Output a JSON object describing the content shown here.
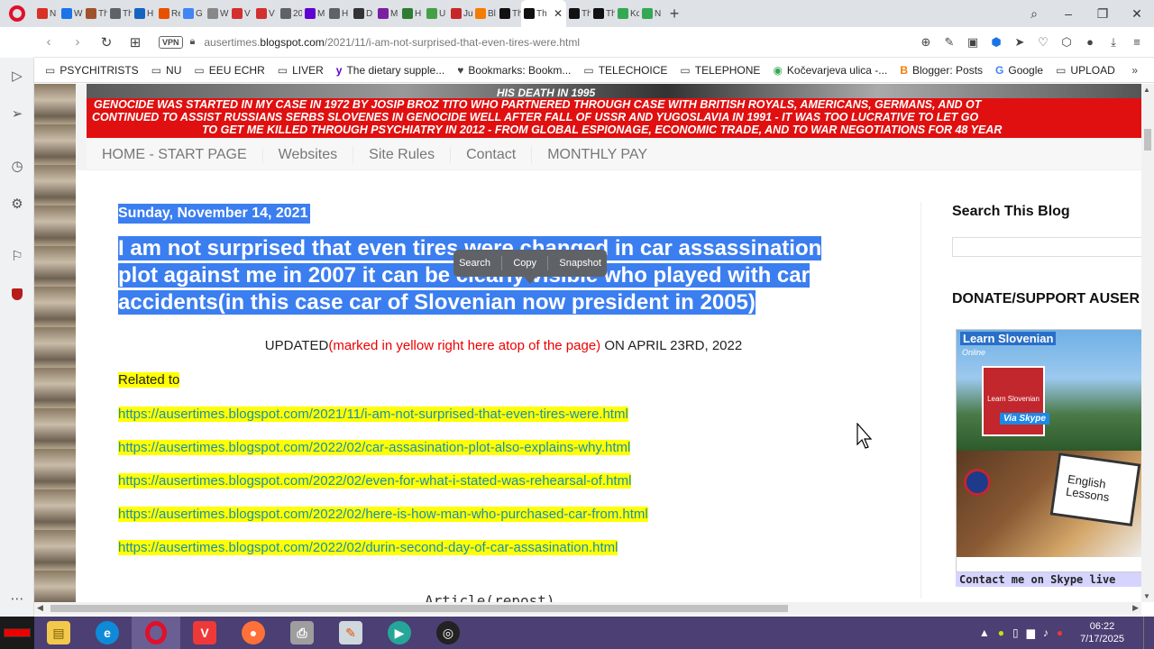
{
  "tabs": [
    {
      "label": "N",
      "color": "#d93025"
    },
    {
      "label": "W",
      "color": "#1a73e8"
    },
    {
      "label": "Th",
      "color": "#a0522d"
    },
    {
      "label": "Th",
      "color": "#5f6368"
    },
    {
      "label": "H",
      "color": "#1565c0"
    },
    {
      "label": "Re",
      "color": "#e65100"
    },
    {
      "label": "G",
      "color": "#4285f4"
    },
    {
      "label": "W",
      "color": "#888888"
    },
    {
      "label": "V",
      "color": "#d32f2f"
    },
    {
      "label": "V",
      "color": "#d32f2f"
    },
    {
      "label": "20",
      "color": "#5f6368"
    },
    {
      "label": "M",
      "color": "#6001d2"
    },
    {
      "label": "H",
      "color": "#5f6368"
    },
    {
      "label": "D",
      "color": "#333333"
    },
    {
      "label": "M",
      "color": "#7b1fa2"
    },
    {
      "label": "H",
      "color": "#2e7d32"
    },
    {
      "label": "U",
      "color": "#43a047"
    },
    {
      "label": "Ju",
      "color": "#c62828"
    },
    {
      "label": "Bl",
      "color": "#f57c00"
    },
    {
      "label": "Th",
      "color": "#111111"
    }
  ],
  "active_tab": {
    "label": "Th"
  },
  "tabs_after": [
    {
      "label": "Th",
      "color": "#111111"
    },
    {
      "label": "Th",
      "color": "#111111"
    },
    {
      "label": "Kc",
      "color": "#34a853"
    },
    {
      "label": "N",
      "color": "#34a853"
    }
  ],
  "address": {
    "url_prefix": "ausertimes.",
    "url_domain": "blogspot.com",
    "url_path": "/2021/11/i-am-not-surprised-that-even-tires-were.html",
    "vpn_label": "VPN"
  },
  "bookmarks": [
    {
      "label": "PSYCHITRISTS",
      "icon": "folder-icon"
    },
    {
      "label": "NU",
      "icon": "folder-icon"
    },
    {
      "label": "EEU ECHR",
      "icon": "folder-icon"
    },
    {
      "label": "LIVER",
      "icon": "folder-icon"
    },
    {
      "label": "The dietary supple...",
      "icon": "yahoo-icon"
    },
    {
      "label": "Bookmarks: Bookm...",
      "icon": "heart-icon"
    },
    {
      "label": "TELECHOICE",
      "icon": "folder-icon"
    },
    {
      "label": "TELEPHONE",
      "icon": "folder-icon"
    },
    {
      "label": "Kočevarjeva ulica -...",
      "icon": "map-pin-icon"
    },
    {
      "label": "Blogger: Posts",
      "icon": "blogger-icon"
    },
    {
      "label": "Google",
      "icon": "google-icon"
    },
    {
      "label": "UPLOAD",
      "icon": "folder-icon"
    }
  ],
  "banner": {
    "death_line": "HIS DEATH IN 1995",
    "line1": "GENOCIDE WAS STARTED IN MY CASE IN 1972 BY JOSIP BROZ TITO WHO PARTNERED THROUGH CASE WITH BRITISH ROYALS, AMERICANS, GERMANS, AND OT",
    "line2": "CONTINUED TO ASSIST RUSSIANS SERBS SLOVENES IN GENOCIDE WELL AFTER FALL OF USSR  AND YUGOSLAVIA IN 1991 - IT WAS TOO LUCRATIVE TO LET GO",
    "line3": "TO GET ME KILLED THROUGH PSYCHIATRY IN 2012 - FROM GLOBAL ESPIONAGE, ECONOMIC TRADE, AND TO WAR NEGOTIATIONS FOR 48 YEAR"
  },
  "menu": [
    "HOME - START PAGE",
    "Websites",
    "Site Rules",
    "Contact",
    "MONTHLY PAY"
  ],
  "popup": {
    "search": "Search",
    "copy": "Copy",
    "snapshot": "Snapshot"
  },
  "post": {
    "date": "Sunday, November 14, 2021",
    "title_lines": [
      "I am not surprised that even tires were changed in car assassination",
      "plot against me in 2007 it can be clearly visible who played with car",
      "accidents(in this case car of Slovenian now president in 2005)"
    ],
    "updated_prefix": "UPDATED",
    "updated_red": "(marked in yellow right here atop of the page)",
    "updated_suffix": " ON APRIL 23RD, 2022",
    "related_label": "Related to",
    "links": [
      "https://ausertimes.blogspot.com/2021/11/i-am-not-surprised-that-even-tires-were.html",
      "https://ausertimes.blogspot.com/2022/02/car-assasination-plot-also-explains-why.html",
      "https://ausertimes.blogspot.com/2022/02/even-for-what-i-stated-was-rehearsal-of.html",
      "https://ausertimes.blogspot.com/2022/02/here-is-how-man-who-purchased-car-from.html",
      "https://ausertimes.blogspot.com/2022/02/durin-second-day-of-car-assasination.html"
    ],
    "article_heading": "Article(repost)"
  },
  "sidebar_right": {
    "search_heading": "Search This Blog",
    "donate_heading": "DONATE/SUPPORT AUSER",
    "ad_learn": "Learn Slovenian",
    "ad_online": "Online",
    "ad_box": "Learn Slovenian",
    "ad_skype": "Via Skype",
    "ad_english_1": "English",
    "ad_english_2": "Lessons",
    "ad_contact": "Contact me on Skype live"
  },
  "taskbar": {
    "time": "06:22",
    "date": "7/17/2025"
  }
}
